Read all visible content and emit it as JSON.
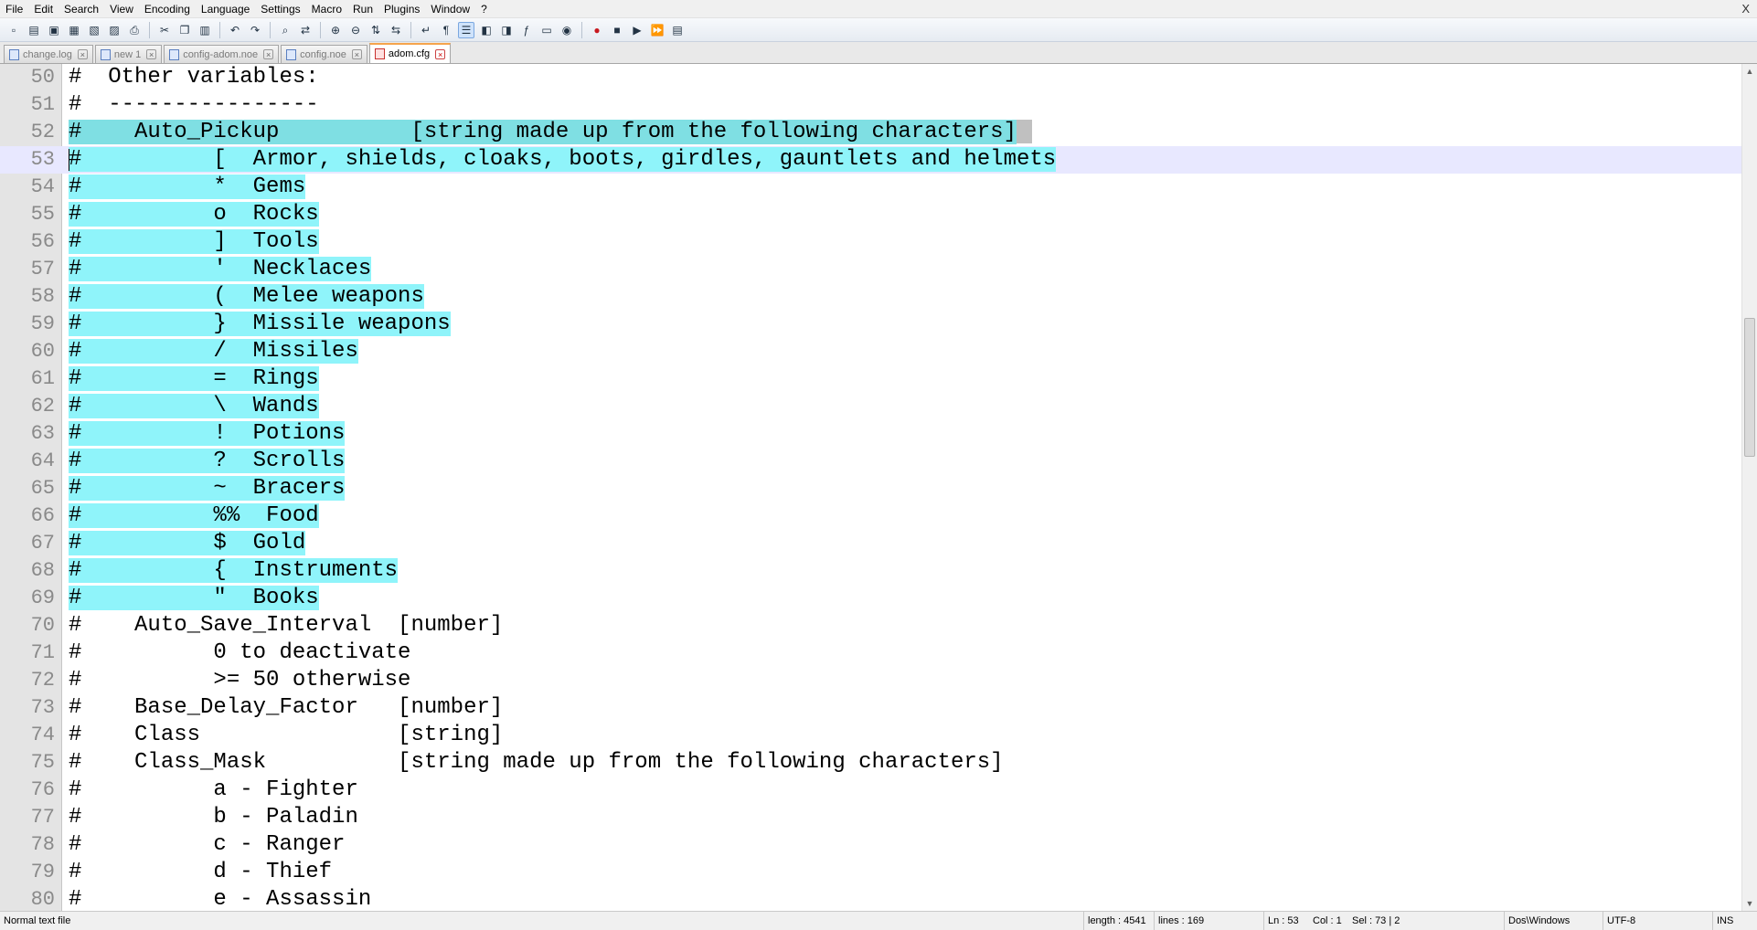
{
  "window": {
    "close_glyph": "X"
  },
  "menu": [
    "File",
    "Edit",
    "Search",
    "View",
    "Encoding",
    "Language",
    "Settings",
    "Macro",
    "Run",
    "Plugins",
    "Window",
    "?"
  ],
  "toolbar": {
    "buttons": [
      {
        "icon": "new-file-icon",
        "glyph": "▫"
      },
      {
        "icon": "open-file-icon",
        "glyph": "▤"
      },
      {
        "icon": "save-icon",
        "glyph": "▣"
      },
      {
        "icon": "save-all-icon",
        "glyph": "▦"
      },
      {
        "icon": "close-file-icon",
        "glyph": "▧"
      },
      {
        "icon": "close-all-icon",
        "glyph": "▨"
      },
      {
        "icon": "print-icon",
        "glyph": "⎙"
      },
      {
        "icon": "cut-icon",
        "glyph": "✂"
      },
      {
        "icon": "copy-icon",
        "glyph": "❐"
      },
      {
        "icon": "paste-icon",
        "glyph": "▥"
      },
      {
        "icon": "undo-icon",
        "glyph": "↶"
      },
      {
        "icon": "redo-icon",
        "glyph": "↷"
      },
      {
        "icon": "find-icon",
        "glyph": "⌕"
      },
      {
        "icon": "replace-icon",
        "glyph": "⇄"
      },
      {
        "icon": "zoom-in-icon",
        "glyph": "⊕"
      },
      {
        "icon": "zoom-out-icon",
        "glyph": "⊖"
      },
      {
        "icon": "sync-vertical-icon",
        "glyph": "⇅"
      },
      {
        "icon": "sync-horizontal-icon",
        "glyph": "⇆"
      },
      {
        "icon": "word-wrap-icon",
        "glyph": "↵"
      },
      {
        "icon": "show-all-chars-icon",
        "glyph": "¶"
      },
      {
        "icon": "indent-guide-icon",
        "glyph": "☰"
      },
      {
        "icon": "user-language-icon",
        "glyph": "◧"
      },
      {
        "icon": "doc-map-icon",
        "glyph": "◨"
      },
      {
        "icon": "function-list-icon",
        "glyph": "ƒ"
      },
      {
        "icon": "folder-workspace-icon",
        "glyph": "▭"
      },
      {
        "icon": "monitoring-icon",
        "glyph": "◉"
      },
      {
        "icon": "record-macro-icon",
        "glyph": "●"
      },
      {
        "icon": "stop-record-icon",
        "glyph": "■"
      },
      {
        "icon": "play-macro-icon",
        "glyph": "▶"
      },
      {
        "icon": "run-macro-multiple-icon",
        "glyph": "⏩"
      },
      {
        "icon": "save-macro-icon",
        "glyph": "▤"
      }
    ]
  },
  "tabs": [
    {
      "label": "change.log",
      "active": false
    },
    {
      "label": "new 1",
      "active": false
    },
    {
      "label": "config-adom.noe",
      "active": false
    },
    {
      "label": "config.noe",
      "active": false
    },
    {
      "label": "adom.cfg",
      "active": true
    }
  ],
  "editor": {
    "lines": [
      {
        "n": "50",
        "text": "#  Other variables:"
      },
      {
        "n": "51",
        "text": "#  ----------------"
      },
      {
        "n": "52",
        "text": "#    Auto_Pickup          [string made up from the following characters]",
        "sel": "all",
        "anchor": true
      },
      {
        "n": "53",
        "text": "#          [  Armor, shields, cloaks, boots, girdles, gauntlets and helmets",
        "sel": "all",
        "current": true
      },
      {
        "n": "54",
        "text": "#          *  Gems",
        "sel": "all"
      },
      {
        "n": "55",
        "text": "#          o  Rocks",
        "sel": "all"
      },
      {
        "n": "56",
        "text": "#          ]  Tools",
        "sel": "all"
      },
      {
        "n": "57",
        "text": "#          '  Necklaces",
        "sel": "all"
      },
      {
        "n": "58",
        "text": "#          (  Melee weapons",
        "sel": "all"
      },
      {
        "n": "59",
        "text": "#          }  Missile weapons",
        "sel": "all"
      },
      {
        "n": "60",
        "text": "#          /  Missiles",
        "sel": "all"
      },
      {
        "n": "61",
        "text": "#          =  Rings",
        "sel": "all"
      },
      {
        "n": "62",
        "text": "#          \\  Wands",
        "sel": "all"
      },
      {
        "n": "63",
        "text": "#          !  Potions",
        "sel": "all"
      },
      {
        "n": "64",
        "text": "#          ?  Scrolls",
        "sel": "all"
      },
      {
        "n": "65",
        "text": "#          ~  Bracers",
        "sel": "all"
      },
      {
        "n": "66",
        "text": "#          %%  Food",
        "sel": "all"
      },
      {
        "n": "67",
        "text": "#          $  Gold",
        "sel": "all"
      },
      {
        "n": "68",
        "text": "#          {  Instruments",
        "sel": "all"
      },
      {
        "n": "69",
        "text": "#          \"  Books",
        "sel": "all"
      },
      {
        "n": "70",
        "text": "#    Auto_Save_Interval  [number]"
      },
      {
        "n": "71",
        "text": "#          0 to deactivate"
      },
      {
        "n": "72",
        "text": "#          >= 50 otherwise"
      },
      {
        "n": "73",
        "text": "#    Base_Delay_Factor   [number]"
      },
      {
        "n": "74",
        "text": "#    Class               [string]"
      },
      {
        "n": "75",
        "text": "#    Class_Mask          [string made up from the following characters]"
      },
      {
        "n": "76",
        "text": "#          a - Fighter"
      },
      {
        "n": "77",
        "text": "#          b - Paladin"
      },
      {
        "n": "78",
        "text": "#          c - Ranger"
      },
      {
        "n": "79",
        "text": "#          d - Thief"
      },
      {
        "n": "80",
        "text": "#          e - Assassin"
      }
    ]
  },
  "statusbar": {
    "file_type": "Normal text file",
    "length": "length : 4541",
    "lines": "lines : 169",
    "ln": "Ln : 53",
    "col": "Col : 1",
    "sel": "Sel : 73 | 2",
    "eol": "Dos\\Windows",
    "encoding": "UTF-8",
    "mode": "INS"
  },
  "colors": {
    "selection": "#8ff4fa",
    "current_line": "#e8e8ff",
    "gutter": "#e4e4e4",
    "active_tab_accent": "#f5a44c"
  }
}
